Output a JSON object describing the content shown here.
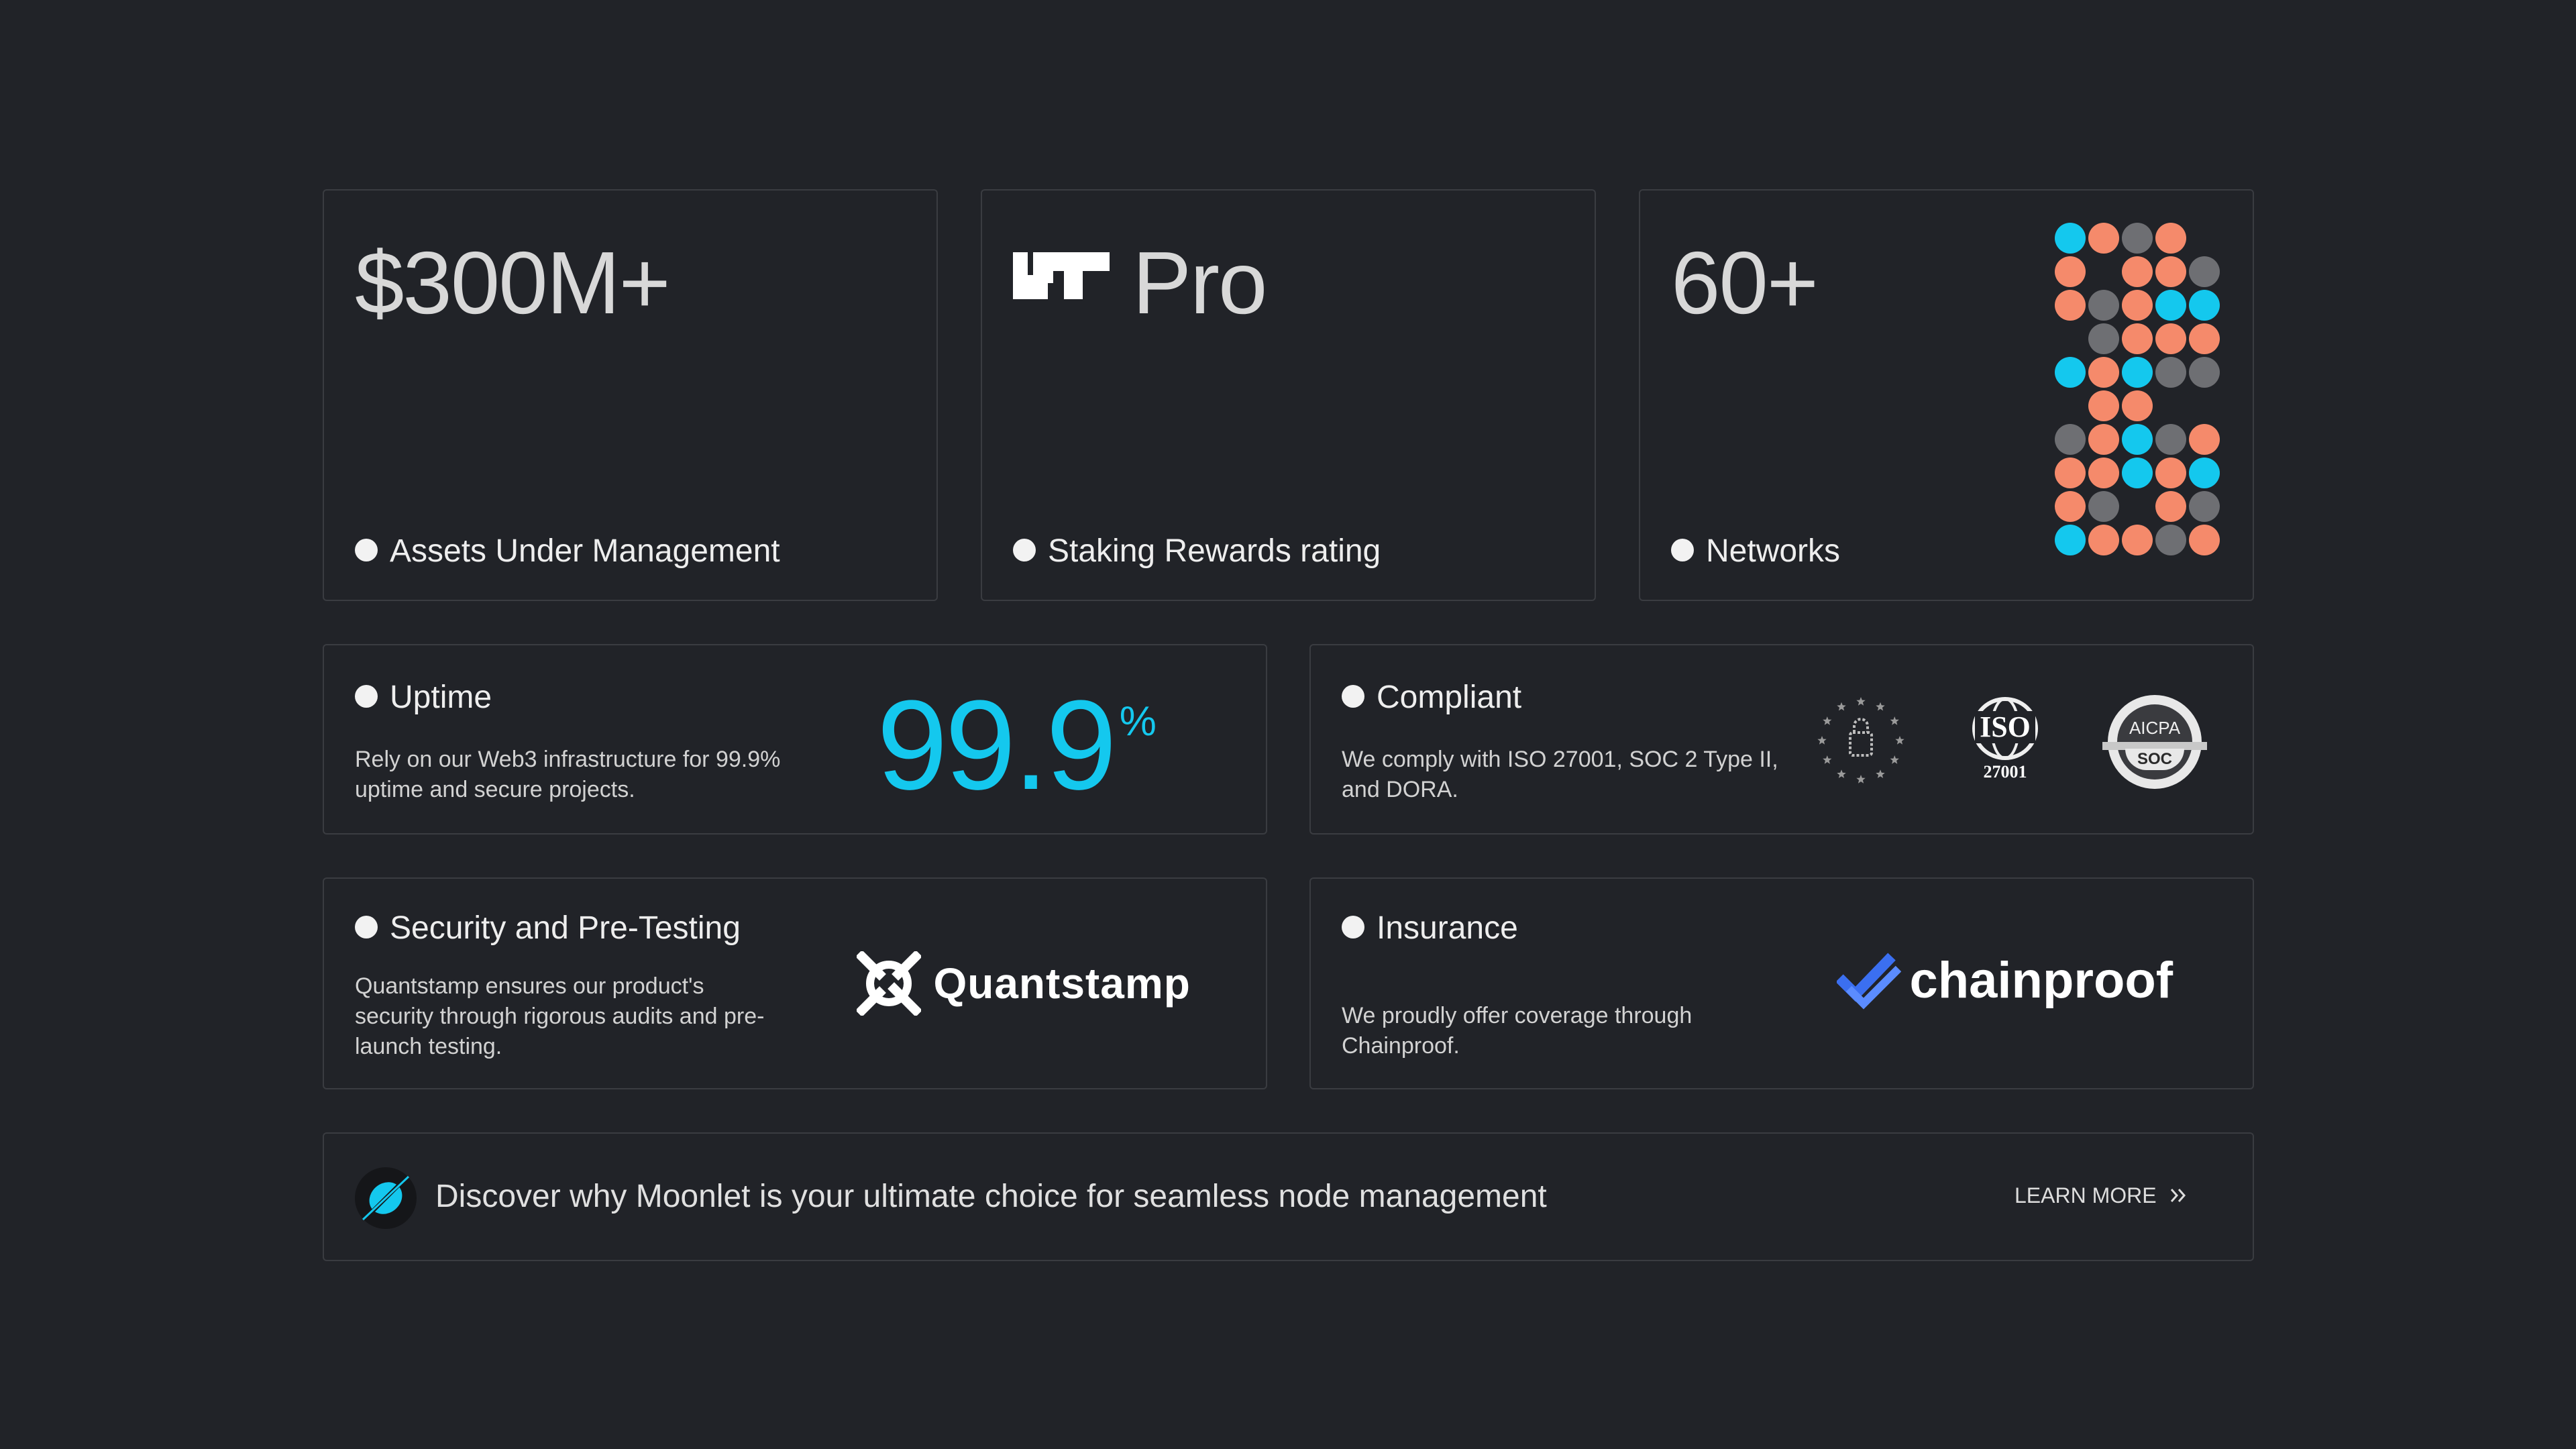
{
  "colors": {
    "background": "#212328",
    "border": "#3a3c41",
    "accent_cyan": "#14c8ee",
    "accent_coral": "#f58a6b",
    "grey_dot": "#6e6f73",
    "chainproof_blue": "#3b6ff0"
  },
  "stats": {
    "assets": {
      "value": "$300M+",
      "label": "Assets Under Management"
    },
    "rating": {
      "value": "Pro",
      "label": "Staking Rewards rating",
      "logo_icon": "staking-rewards-logo-icon"
    },
    "networks": {
      "value": "60+",
      "label": "Networks"
    }
  },
  "network_grid": [
    [
      "cyan",
      "coral",
      "grey",
      "coral",
      "none"
    ],
    [
      "coral",
      "none",
      "coral",
      "coral",
      "grey"
    ],
    [
      "coral",
      "grey",
      "coral",
      "cyan",
      "cyan"
    ],
    [
      "none",
      "grey",
      "coral",
      "coral",
      "coral"
    ],
    [
      "cyan",
      "coral",
      "cyan",
      "grey",
      "grey"
    ],
    [
      "none",
      "coral",
      "coral",
      "none",
      "none"
    ],
    [
      "grey",
      "coral",
      "cyan",
      "grey",
      "coral"
    ],
    [
      "coral",
      "coral",
      "cyan",
      "coral",
      "cyan"
    ],
    [
      "coral",
      "grey",
      "none",
      "coral",
      "grey"
    ],
    [
      "cyan",
      "coral",
      "coral",
      "grey",
      "coral"
    ]
  ],
  "uptime": {
    "label": "Uptime",
    "description": "Rely on our Web3 infrastructure for 99.9% uptime and secure projects.",
    "value": "99.9",
    "unit": "%"
  },
  "compliant": {
    "label": "Compliant",
    "description": "We comply with ISO 27001, SOC 2 Type II, and DORA.",
    "badges": {
      "iso_top": "ISO",
      "iso_bottom": "27001",
      "aicpa_top": "AICPA",
      "aicpa_bottom": "SOC"
    }
  },
  "security": {
    "label": "Security and Pre-Testing",
    "description": "Quantstamp ensures our product's security through rigorous audits and pre-launch testing.",
    "partner": "Quantstamp"
  },
  "insurance": {
    "label": "Insurance",
    "description": "We proudly offer coverage through Chainproof.",
    "partner": "chainproof"
  },
  "banner": {
    "text": "Discover why Moonlet is your ultimate choice for seamless node management",
    "cta": "LEARN MORE",
    "cta_icon": "double-chevron-right-icon"
  }
}
